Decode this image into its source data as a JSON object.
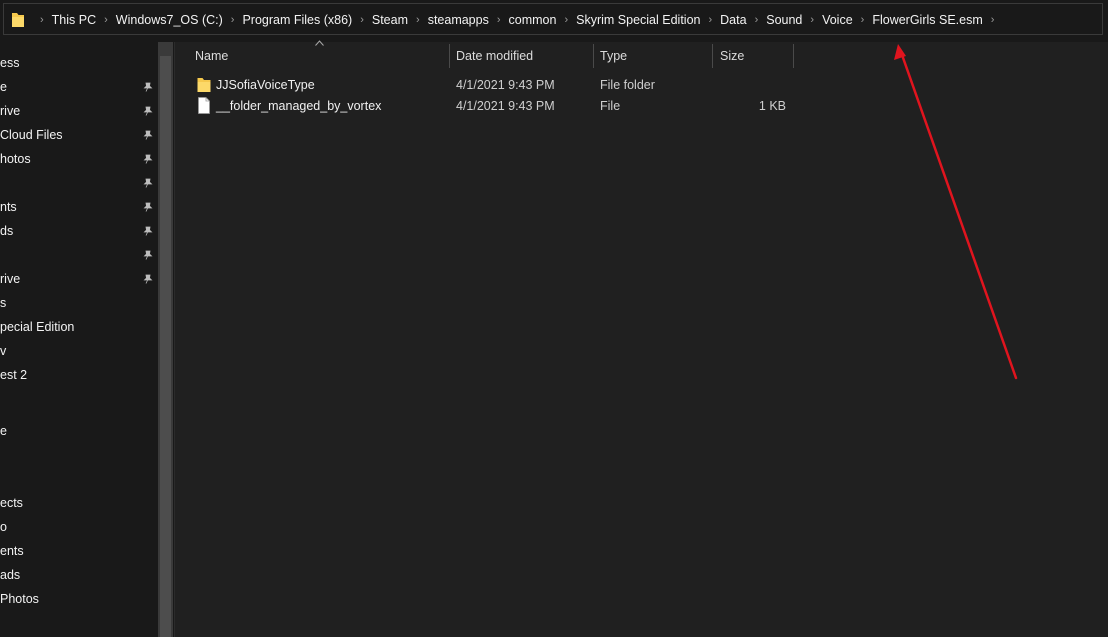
{
  "address_bar": {
    "breadcrumbs": [
      "This PC",
      "Windows7_OS (C:)",
      "Program Files (x86)",
      "Steam",
      "steamapps",
      "common",
      "Skyrim Special Edition",
      "Data",
      "Sound",
      "Voice",
      "FlowerGirls SE.esm"
    ]
  },
  "sidebar": {
    "items": [
      {
        "label": "ess",
        "pinned": false
      },
      {
        "label": "e",
        "pinned": true
      },
      {
        "label": "rive",
        "pinned": true
      },
      {
        "label": "Cloud Files",
        "pinned": true
      },
      {
        "label": "hotos",
        "pinned": true
      },
      {
        "label": "",
        "pinned": true
      },
      {
        "label": "nts",
        "pinned": true
      },
      {
        "label": "ds",
        "pinned": true
      },
      {
        "label": "",
        "pinned": true
      },
      {
        "label": "rive",
        "pinned": true
      },
      {
        "label": "s",
        "pinned": false
      },
      {
        "label": "pecial Edition",
        "pinned": false
      },
      {
        "label": "v",
        "pinned": false
      },
      {
        "label": "est 2",
        "pinned": false
      },
      {
        "label": "",
        "pinned": false
      },
      {
        "label": "e",
        "pinned": false
      },
      {
        "label": "",
        "pinned": false
      },
      {
        "label": "ects",
        "pinned": false
      },
      {
        "label": "o",
        "pinned": false
      },
      {
        "label": "ents",
        "pinned": false
      },
      {
        "label": "ads",
        "pinned": false
      },
      {
        "label": "Photos",
        "pinned": false
      }
    ]
  },
  "file_list": {
    "columns": [
      "Name",
      "Date modified",
      "Type",
      "Size"
    ],
    "sort_column": "Name",
    "rows": [
      {
        "name": "JJSofiaVoiceType",
        "date_modified": "4/1/2021 9:43 PM",
        "type": "File folder",
        "size": "",
        "icon": "folder-icon"
      },
      {
        "name": "__folder_managed_by_vortex",
        "date_modified": "4/1/2021 9:43 PM",
        "type": "File",
        "size": "1 KB",
        "icon": "file-icon"
      }
    ]
  },
  "annotation": {
    "color": "#e0141e",
    "icon": "red-arrow-annotation"
  },
  "colors": {
    "folder": "#f6c94d",
    "background": "#202020",
    "sidebar": "#191919"
  }
}
